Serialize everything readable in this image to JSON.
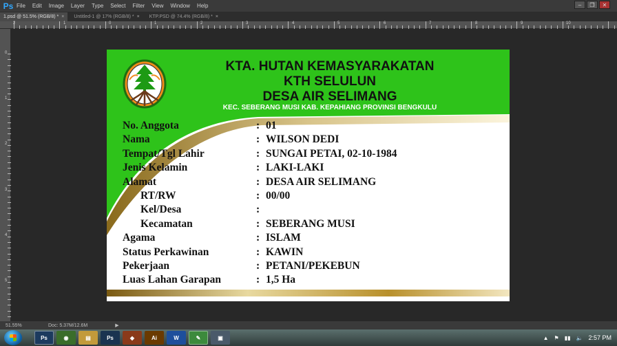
{
  "app": {
    "logo": "Ps",
    "menu": [
      "File",
      "Edit",
      "Image",
      "Layer",
      "Type",
      "Select",
      "Filter",
      "View",
      "Window",
      "Help"
    ],
    "window_controls": [
      "–",
      "❐",
      "✕"
    ]
  },
  "tabs": [
    {
      "label": "1.psd @ 51.5% (RGB/8) *",
      "active": true
    },
    {
      "label": "Untitled-1 @ 17% (RGB/8) *",
      "active": false
    },
    {
      "label": "KTP.PSD @ 74.4% (RGB/8) *",
      "active": false
    }
  ],
  "ruler": {
    "h_labels": [
      "2",
      "1",
      "0",
      "1",
      "2",
      "3",
      "4",
      "5",
      "6",
      "7",
      "8",
      "9",
      "10"
    ],
    "v_labels": [
      "0",
      "1",
      "2",
      "3",
      "4",
      "5"
    ]
  },
  "card": {
    "title1": "KTA. HUTAN KEMASYARAKATAN",
    "title2": "KTH SELULUN",
    "title3": "DESA AIR SELIMANG",
    "subtitle": "KEC. SEBERANG MUSI KAB. KEPAHIANG PROVINSI BENGKULU",
    "colors": {
      "green": "#2ec31a",
      "gold": "#b8902c",
      "dark_green": "#1d8f10"
    },
    "fields": [
      {
        "label": "No. Anggota",
        "value": "01",
        "sub": false
      },
      {
        "label": "Nama",
        "value": "WILSON DEDI",
        "sub": false
      },
      {
        "label": "Tempat/Tgl Lahir",
        "value": "SUNGAI PETAI, 02-10-1984",
        "sub": false
      },
      {
        "label": "Jenis Kelamin",
        "value": "LAKI-LAKI",
        "sub": false
      },
      {
        "label": "Alamat",
        "value": "DESA AIR SELIMANG",
        "sub": false
      },
      {
        "label": "RT/RW",
        "value": "00/00",
        "sub": true
      },
      {
        "label": "Kel/Desa",
        "value": "",
        "sub": true
      },
      {
        "label": "Kecamatan",
        "value": "SEBERANG MUSI",
        "sub": true
      },
      {
        "label": "Agama",
        "value": "ISLAM",
        "sub": false
      },
      {
        "label": "Status Perkawinan",
        "value": "KAWIN",
        "sub": false
      },
      {
        "label": "Pekerjaan",
        "value": "PETANI/PEKEBUN",
        "sub": false
      },
      {
        "label": "Luas Lahan Garapan",
        "value": "1,5 Ha",
        "sub": false
      }
    ],
    "colon": ":"
  },
  "status": {
    "zoom": "51.55%",
    "doc": "Doc: 5.37M/12.6M",
    "arrow": "▶"
  },
  "taskbar": {
    "apps": [
      {
        "label": "Ps",
        "color": "#1c3a5e",
        "active": true
      },
      {
        "label": "◉",
        "color": "#3a6d2a",
        "active": false
      },
      {
        "label": "▤",
        "color": "#c29a3a",
        "active": false
      },
      {
        "label": "Ps",
        "color": "#1a3350",
        "active": false
      },
      {
        "label": "◆",
        "color": "#8a3a1a",
        "active": false
      },
      {
        "label": "Ai",
        "color": "#6a3a00",
        "active": false
      },
      {
        "label": "W",
        "color": "#1e4f9c",
        "active": false
      },
      {
        "label": "✎",
        "color": "#3c8a3c",
        "active": true
      },
      {
        "label": "▣",
        "color": "#4a5a6a",
        "active": false
      }
    ],
    "tray_icons": [
      "▲",
      "⚑",
      "▮▮",
      "🔈"
    ],
    "clock": "2:57 PM"
  }
}
